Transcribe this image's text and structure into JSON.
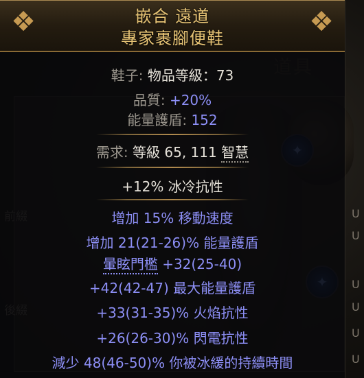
{
  "background": {
    "panel_title": "道具",
    "prefix_label": "前綴",
    "suffix_label": "後綴",
    "side_marker": "U",
    "socket_color": "#1d3c7a"
  },
  "item": {
    "name_line1": "嵌合 遠道",
    "name_line2": "專家裹腳便鞋",
    "header_color": "#e5c274",
    "corner_icon": "ornament-icon"
  },
  "properties": {
    "base_label": "鞋子:",
    "item_level_label": "物品等級：",
    "item_level_value": "73",
    "quality_label": "品質:",
    "quality_value": "+20%",
    "energy_shield_label": "能量護盾:",
    "energy_shield_value": "152"
  },
  "requirements": {
    "label": "需求:",
    "level_label": "等級",
    "level_value": "65,",
    "int_value": "111",
    "int_label": "智慧"
  },
  "implicit": "+12% 冰冷抗性",
  "explicit_mods": [
    {
      "text": "增加 15% 移動速度"
    },
    {
      "text": "增加 21(21-26)% 能量護盾"
    },
    {
      "prefix": "暈眩門檻",
      "text": " +32(25-40)"
    },
    {
      "text": "+42(42-47) 最大能量護盾"
    },
    {
      "text": "+33(31-35)% 火焰抗性"
    },
    {
      "text": "+26(26-30)% 閃電抗性"
    },
    {
      "text": "減少 48(46-50)% 你被冰緩的持續時間"
    }
  ],
  "colors": {
    "magic_blue": "#8d8ff6",
    "label_grey": "#9a958c",
    "value_white": "#e6e2d9",
    "separator_gold": "#b08a4e"
  }
}
